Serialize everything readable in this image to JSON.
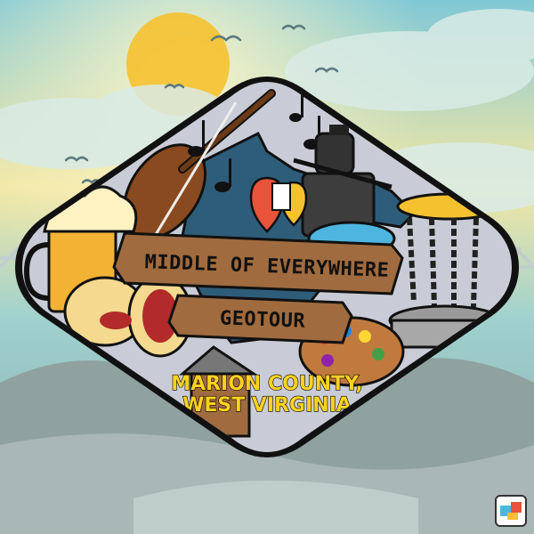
{
  "badge": {
    "banner_title": "MIDDLE OF EVERYWHERE",
    "banner_subtitle": "GEOTOUR",
    "location_line1": "MARION COUNTY,",
    "location_line2": "WEST VIRGINIA"
  },
  "colors": {
    "sky_top": "#7ec8d8",
    "sky_glow": "#f4e9a6",
    "sun": "#f6c12f",
    "badge_fill": "#c9ccd6",
    "badge_outline": "#111111",
    "banner": "#a06b3e",
    "county_text": "#ffd21f",
    "state_shape": "#2e5d7a",
    "beer": "#f2b233",
    "foam": "#fff2c2",
    "disc": "#4db5e0",
    "basket": "#f6c12f",
    "water": "#3a7fb0",
    "hills": "#8fa2a0"
  },
  "icons": {
    "violin": "violin-icon",
    "music_notes": "music-note-icon",
    "miner_statue": "miner-statue-icon",
    "state_outline": "west-virginia-outline-icon",
    "map_pin": "geocache-pin-icon",
    "beer_mug": "beer-mug-icon",
    "pepperoni_roll": "pepperoni-roll-icon",
    "flying_disc": "flying-disc-icon",
    "disc_golf_basket": "disc-golf-basket-icon",
    "art_palette": "paint-palette-icon",
    "log_cabin": "cabin-icon",
    "bridge": "bridge-icon",
    "birds": "bird-icon",
    "sun": "sun-icon",
    "corner_logo": "geocaching-logo-icon"
  }
}
